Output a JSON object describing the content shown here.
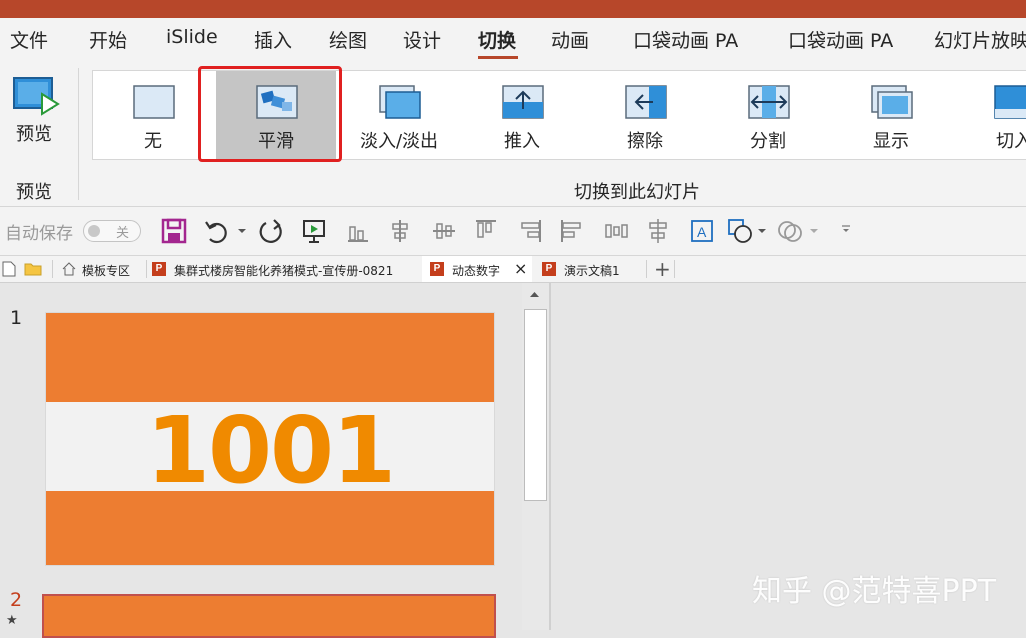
{
  "menu": {
    "items": [
      "文件",
      "开始",
      "iSlide",
      "插入",
      "绘图",
      "设计",
      "切换",
      "动画",
      "口袋动画 PA",
      "口袋动画 PA",
      "幻灯片放映"
    ],
    "active": "切换"
  },
  "ribbon": {
    "preview_label": "预览",
    "preview_group": "预览",
    "group_label": "切换到此幻灯片",
    "transitions": [
      {
        "label": "无"
      },
      {
        "label": "平滑",
        "selected": true
      },
      {
        "label": "淡入/淡出"
      },
      {
        "label": "推入"
      },
      {
        "label": "擦除"
      },
      {
        "label": "分割"
      },
      {
        "label": "显示"
      },
      {
        "label": "切入"
      }
    ]
  },
  "qat": {
    "autosave_label": "自动保存",
    "toggle_state": "关"
  },
  "tabs": [
    {
      "label": "模板专区"
    },
    {
      "label": "集群式楼房智能化养猪模式-宣传册-0821"
    },
    {
      "label": "动态数字",
      "active": true,
      "close": "×"
    },
    {
      "label": "演示文稿1"
    },
    {
      "label": "+"
    }
  ],
  "thumbnails": {
    "slide1_number": "1",
    "slide1_text": "1001",
    "slide2_number": "2",
    "slide2_marker": "★"
  },
  "watermark": "知乎 @范特喜PPT",
  "colors": {
    "accent": "#b7472a",
    "slide_orange": "#ed7d31",
    "number_orange": "#f08a00",
    "highlight_red": "#e02020"
  }
}
